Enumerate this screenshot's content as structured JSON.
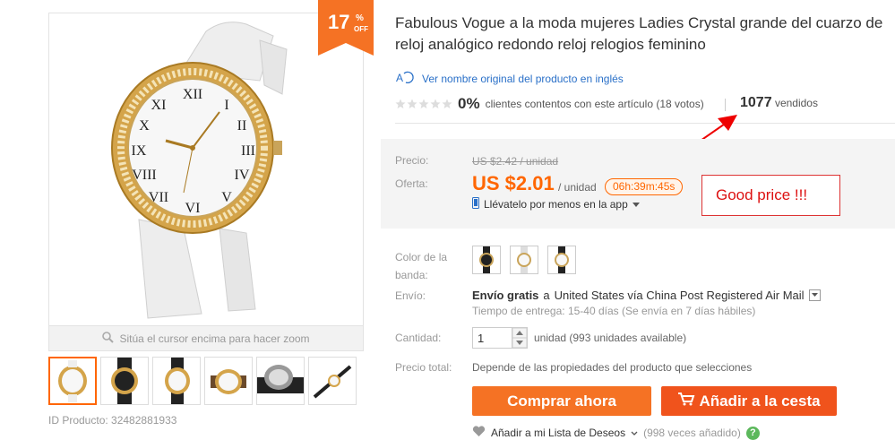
{
  "discount": {
    "value": "17",
    "percent": "%",
    "off": "OFF"
  },
  "gallery": {
    "zoom_hint": "Sitúa el cursor encima para hacer zoom",
    "product_id_label": "ID Producto: 32482881933"
  },
  "title_line1": "Fabulous Vogue a la moda mujeres Ladies Crystal grande del cuarzo de",
  "title_line2": "reloj analógico redondo reloj relogios feminino",
  "translate_link": "Ver nombre original del producto en inglés",
  "rating": {
    "percent": "0%",
    "text": "clientes contentos con este artículo (18 votos)"
  },
  "sold": {
    "count": "1077",
    "label": "vendidos"
  },
  "price": {
    "label_price": "Precio:",
    "old": "US $2.42 / unidad",
    "label_offer": "Oferta:",
    "new": "US $2.01",
    "unit": "/ unidad",
    "timer": "06h:39m:45s",
    "app_text": "Llévatelo por menos en la app"
  },
  "annotation": {
    "text": "Good price !!!",
    "color": "#d11111"
  },
  "options": {
    "color_label_1": "Color de la",
    "color_label_2": "banda:",
    "shipping_label": "Envío:",
    "shipping_free": "Envío gratis",
    "shipping_to": "a",
    "shipping_dest": "United States vía China Post Registered Air Mail",
    "shipping_time": "Tiempo de entrega: 15-40 días (Se envía en 7 días hábiles)",
    "qty_label": "Cantidad:",
    "qty_value": "1",
    "qty_note": "unidad (993 unidades available)",
    "total_label": "Precio total:",
    "total_note": "Depende de las propiedades del producto que selecciones"
  },
  "buttons": {
    "buy": "Comprar ahora",
    "cart": "Añadir a la cesta"
  },
  "wishlist": {
    "label": "Añadir a mi Lista de Deseos",
    "count": "(998 veces añadido)",
    "help": "?"
  },
  "colors": {
    "accent": "#f60",
    "buy": "#f57224",
    "cart": "#f0531c"
  }
}
